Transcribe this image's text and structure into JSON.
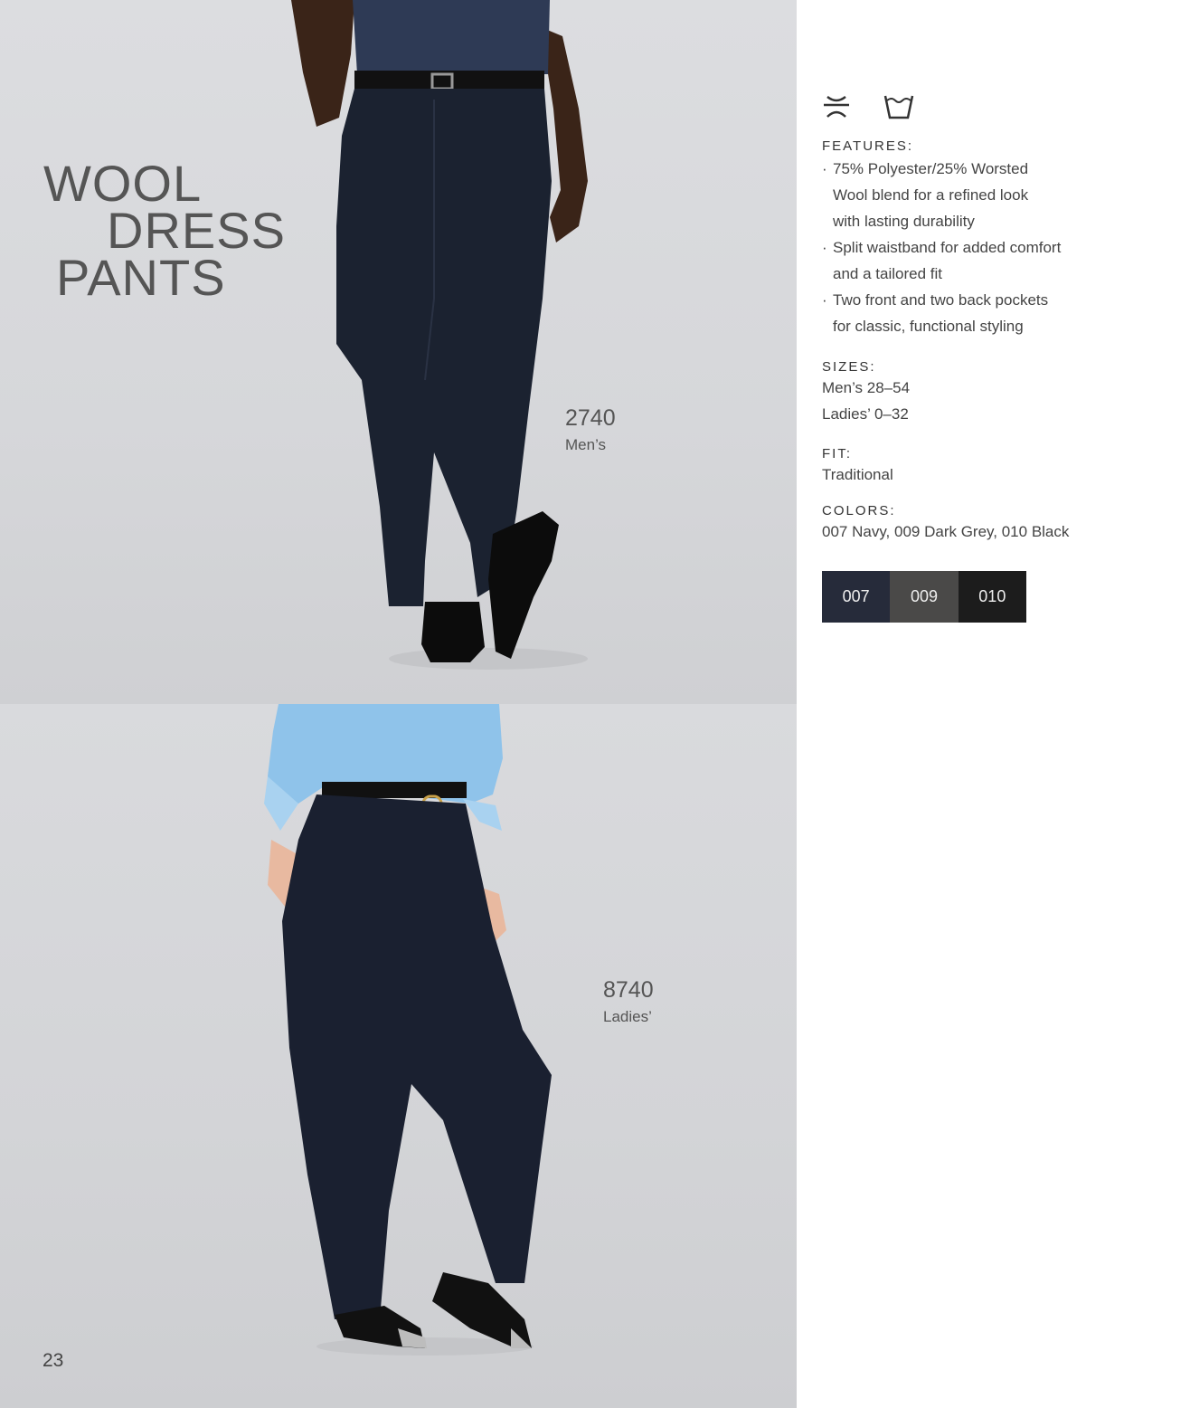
{
  "title": {
    "line1": "WOOL",
    "line2": "DRESS",
    "line3": "PANTS"
  },
  "products": [
    {
      "number": "2740",
      "label": "Men’s"
    },
    {
      "number": "8740",
      "label": "Ladies’"
    }
  ],
  "icons": [
    "do-not-iron-icon",
    "wash-tub-icon"
  ],
  "features": {
    "heading": "FEATURES:",
    "bullet": "·",
    "items": [
      [
        "75% Polyester/25% Worsted",
        "Wool blend for a refined look",
        "with lasting durability"
      ],
      [
        "Split waistband for added comfort",
        "and a tailored fit"
      ],
      [
        "Two front and two back pockets",
        "for classic, functional styling"
      ]
    ]
  },
  "sizes": {
    "heading": "SIZES:",
    "lines": [
      "Men’s 28–54",
      "Ladies’ 0–32"
    ]
  },
  "fit": {
    "heading": "FIT:",
    "value": "Traditional"
  },
  "colors": {
    "heading": "COLORS:",
    "value": "007 Navy, 009 Dark Grey, 010 Black",
    "swatches": [
      {
        "code": "007",
        "hex": "#262b3a"
      },
      {
        "code": "009",
        "hex": "#4a4948"
      },
      {
        "code": "010",
        "hex": "#1c1c1c"
      }
    ]
  },
  "page_number": "23"
}
